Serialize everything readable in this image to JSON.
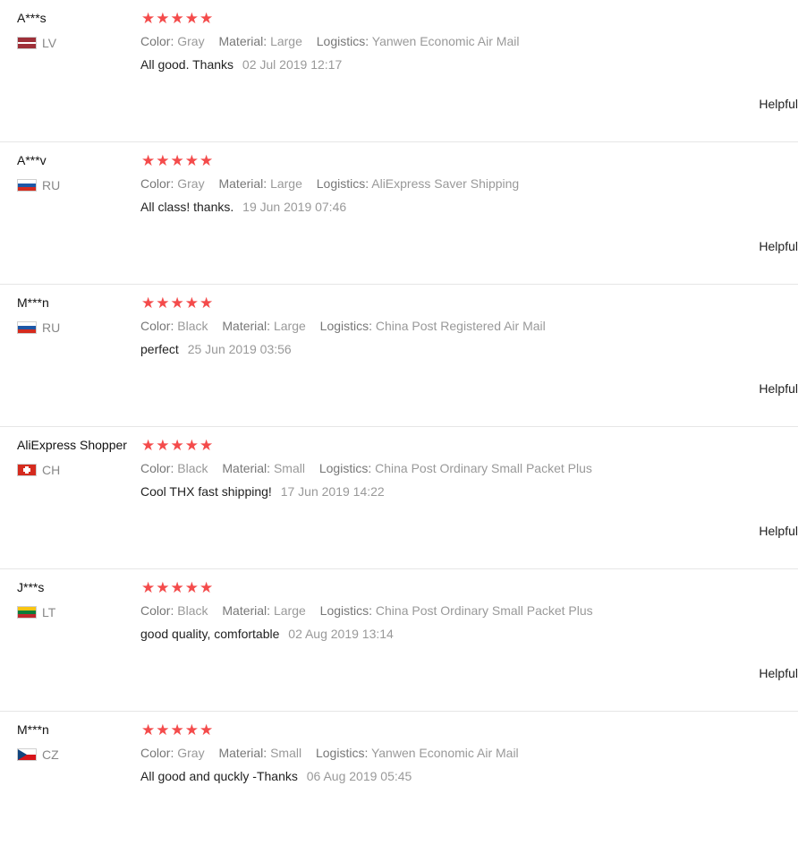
{
  "labels": {
    "color": "Color:",
    "material": "Material:",
    "logistics": "Logistics:",
    "helpful": "Helpful"
  },
  "stars": "★★★★★",
  "reviews": [
    {
      "user": "A***s",
      "country": "LV",
      "color": "Gray",
      "material": "Large",
      "logistics": "Yanwen Economic Air Mail",
      "text": "All good. Thanks",
      "date": "02 Jul 2019 12:17"
    },
    {
      "user": "A***v",
      "country": "RU",
      "color": "Gray",
      "material": "Large",
      "logistics": "AliExpress Saver Shipping",
      "text": "All class! thanks.",
      "date": "19 Jun 2019 07:46"
    },
    {
      "user": "M***n",
      "country": "RU",
      "color": "Black",
      "material": "Large",
      "logistics": "China Post Registered Air Mail",
      "text": "perfect",
      "date": "25 Jun 2019 03:56"
    },
    {
      "user": "AliExpress Shopper",
      "country": "CH",
      "color": "Black",
      "material": "Small",
      "logistics": "China Post Ordinary Small Packet Plus",
      "text": "Cool THX fast shipping!",
      "date": "17 Jun 2019 14:22"
    },
    {
      "user": "J***s",
      "country": "LT",
      "color": "Black",
      "material": "Large",
      "logistics": "China Post Ordinary Small Packet Plus",
      "text": "good quality, comfortable",
      "date": "02 Aug 2019 13:14"
    },
    {
      "user": "M***n",
      "country": "CZ",
      "color": "Gray",
      "material": "Small",
      "logistics": "Yanwen Economic Air Mail",
      "text": "All good and quckly -Thanks",
      "date": "06 Aug 2019 05:45"
    }
  ]
}
